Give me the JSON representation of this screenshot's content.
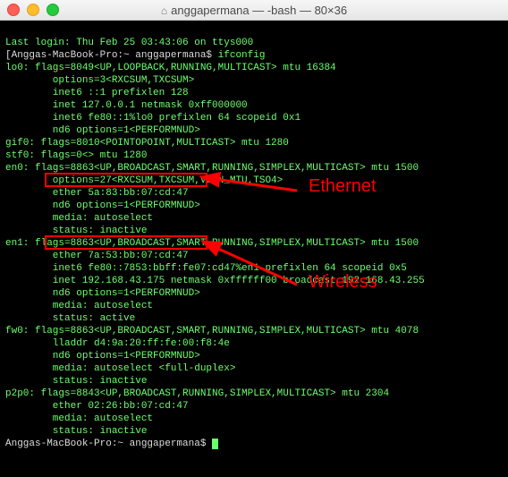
{
  "window": {
    "title": "anggapermana — -bash — 80×36"
  },
  "term": {
    "lastlogin": "Last login: Thu Feb 25 03:43:06 on ttys000",
    "prompt1_host": "[Anggas-MacBook-Pro:~ anggapermana$ ",
    "cmd1": "ifconfig",
    "lines": [
      "lo0: flags=8049<UP,LOOPBACK,RUNNING,MULTICAST> mtu 16384",
      "        options=3<RXCSUM,TXCSUM>",
      "        inet6 ::1 prefixlen 128",
      "        inet 127.0.0.1 netmask 0xff000000",
      "        inet6 fe80::1%lo0 prefixlen 64 scopeid 0x1",
      "        nd6 options=1<PERFORMNUD>",
      "gif0: flags=8010<POINTOPOINT,MULTICAST> mtu 1280",
      "stf0: flags=0<> mtu 1280",
      "en0: flags=8863<UP,BROADCAST,SMART,RUNNING,SIMPLEX,MULTICAST> mtu 1500",
      "        options=27<RXCSUM,TXCSUM,VLAN_MTU,TSO4>",
      "        ether 5a:83:bb:07:cd:47",
      "        nd6 options=1<PERFORMNUD>",
      "        media: autoselect",
      "        status: inactive",
      "en1: flags=8863<UP,BROADCAST,SMART,RUNNING,SIMPLEX,MULTICAST> mtu 1500",
      "        ether 7a:53:bb:07:cd:47",
      "        inet6 fe80::7853:bbff:fe07:cd47%en1 prefixlen 64 scopeid 0x5",
      "        inet 192.168.43.175 netmask 0xffffff00 broadcast 192.168.43.255",
      "        nd6 options=1<PERFORMNUD>",
      "        media: autoselect",
      "        status: active",
      "fw0: flags=8863<UP,BROADCAST,SMART,RUNNING,SIMPLEX,MULTICAST> mtu 4078",
      "        lladdr d4:9a:20:ff:fe:00:f8:4e",
      "        nd6 options=1<PERFORMNUD>",
      "        media: autoselect <full-duplex>",
      "        status: inactive",
      "p2p0: flags=8843<UP,BROADCAST,RUNNING,SIMPLEX,MULTICAST> mtu 2304",
      "        ether 02:26:bb:07:cd:47",
      "        media: autoselect",
      "        status: inactive"
    ],
    "prompt2_host": "Anggas-MacBook-Pro:~ anggapermana$ "
  },
  "annotations": {
    "ethernet_label": "Ethernet",
    "wireless_label": "Wireless"
  }
}
